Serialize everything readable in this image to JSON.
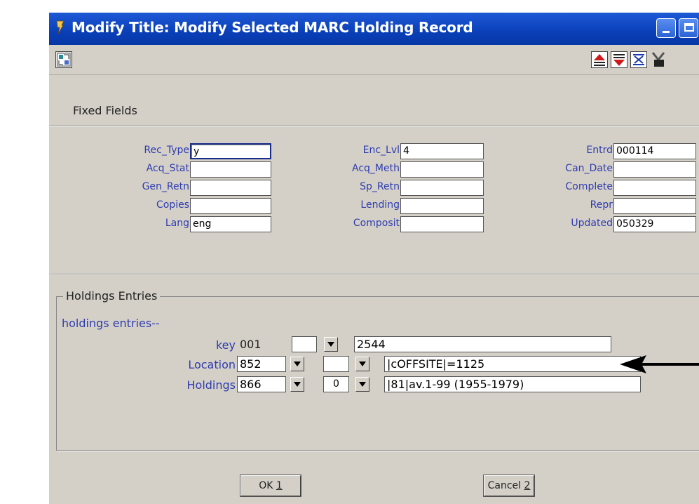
{
  "window": {
    "title": "Modify Title: Modify Selected MARC Holding Record"
  },
  "fixed_fields": {
    "heading": "Fixed Fields",
    "col1": [
      {
        "label": "Rec_Type",
        "value": "y"
      },
      {
        "label": "Acq_Stat",
        "value": ""
      },
      {
        "label": "Gen_Retn",
        "value": ""
      },
      {
        "label": "Copies",
        "value": ""
      },
      {
        "label": "Lang",
        "value": "eng"
      }
    ],
    "col2": [
      {
        "label": "Enc_Lvl",
        "value": "4"
      },
      {
        "label": "Acq_Meth",
        "value": ""
      },
      {
        "label": "Sp_Retn",
        "value": ""
      },
      {
        "label": "Lending",
        "value": ""
      },
      {
        "label": "Composit",
        "value": ""
      }
    ],
    "col3": [
      {
        "label": "Entrd",
        "value": "000114"
      },
      {
        "label": "Can_Date",
        "value": ""
      },
      {
        "label": "Complete",
        "value": ""
      },
      {
        "label": "Repr",
        "value": ""
      },
      {
        "label": "Updated",
        "value": "050329"
      }
    ]
  },
  "holdings": {
    "heading": "Holdings Entries",
    "subheading": "holdings entries--",
    "key": {
      "label": "key",
      "tag": "001",
      "ind": "",
      "value": "2544"
    },
    "location": {
      "label": "Location",
      "tag": "852",
      "ind": "",
      "value": "|cOFFSITE|=1125"
    },
    "holdings": {
      "label": "Holdings",
      "tag": "866",
      "ind": "0",
      "value": "|81|av.1-99 (1955-1979)"
    }
  },
  "buttons": {
    "ok": "OK",
    "ok_key": "1",
    "cancel": "Cancel",
    "cancel_key": "2"
  },
  "icons": [
    "window-icon",
    "minimize-icon",
    "restore-icon",
    "tool-icon",
    "move-up-icon",
    "move-down-icon",
    "delete-icon",
    "scissors-icon",
    "arrow-icon"
  ]
}
